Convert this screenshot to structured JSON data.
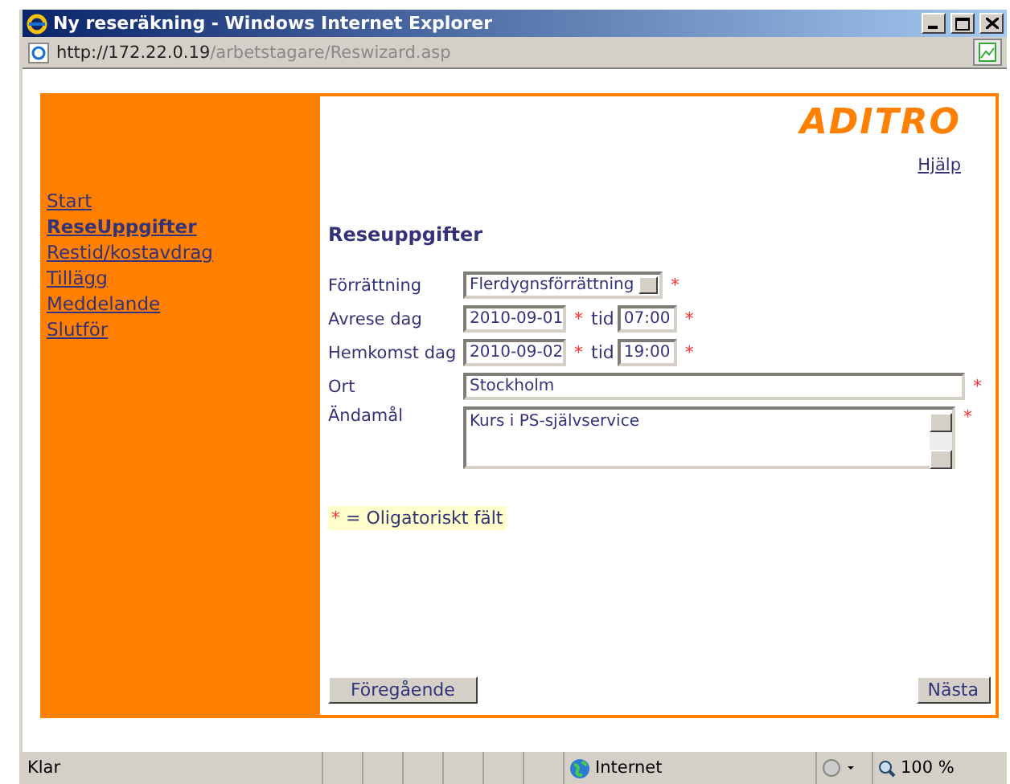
{
  "window": {
    "title": "Ny reseräkning - Windows Internet Explorer",
    "address_host": "http://172.22.0.19",
    "address_path": "/arbetstagare/Reswizard.asp"
  },
  "logo": "ADITRO",
  "help_link": "Hjälp",
  "sidebar": {
    "items": [
      {
        "label": "Start",
        "selected": false
      },
      {
        "label": "ReseUppgifter",
        "selected": true
      },
      {
        "label": "Restid/kostavdrag",
        "selected": false
      },
      {
        "label": "Tillägg",
        "selected": false
      },
      {
        "label": "Meddelande",
        "selected": false
      },
      {
        "label": "Slutför",
        "selected": false
      }
    ]
  },
  "form": {
    "heading": "Reseuppgifter",
    "rows": [
      {
        "kind": "select",
        "label": "Förrättning",
        "value": "Flerdygnsförrättning",
        "mark": "*"
      },
      {
        "kind": "datetime",
        "label": "Avrese dag",
        "value": "2010-09-01",
        "mark": "*",
        "time_label": "tid",
        "time": "07:00",
        "time_mark": "*"
      },
      {
        "kind": "datetime",
        "label": "Hemkomst dag",
        "value": "2010-09-02",
        "mark": "*",
        "time_label": "tid",
        "time": "19:00",
        "time_mark": "*"
      },
      {
        "kind": "text",
        "label": "Ort",
        "value": "Stockholm",
        "mark": "*"
      },
      {
        "kind": "textarea",
        "label": "Ändamål",
        "value": "Kurs i PS-självservice",
        "mark": "*"
      }
    ],
    "legend_mark": "*",
    "legend": "= Oligatoriskt fält"
  },
  "buttons": [
    {
      "label": "Föregående"
    },
    {
      "label": "Nästa"
    }
  ],
  "status_bar": {
    "status": "Klar",
    "zone": "Internet",
    "zoom": "100 %"
  }
}
